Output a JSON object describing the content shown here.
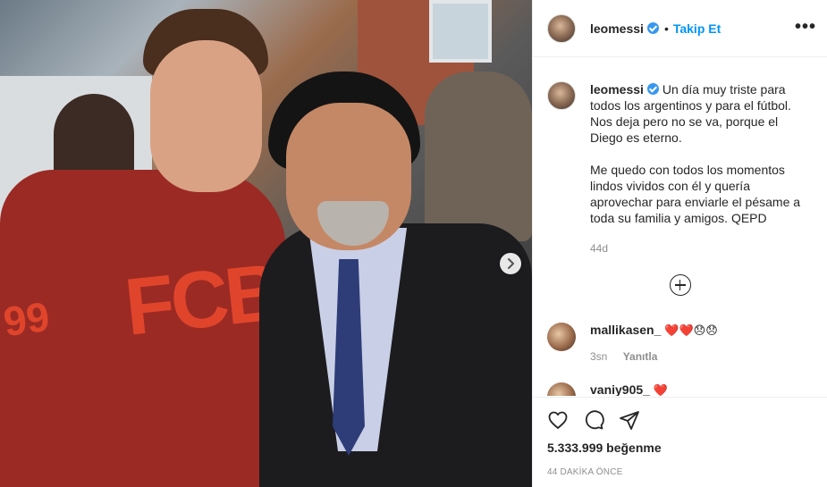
{
  "post": {
    "username": "leomessi",
    "follow_label": "Takip Et",
    "separator": "•",
    "more_label": "•••"
  },
  "caption": {
    "username": "leomessi",
    "paragraph1": "Un día muy triste para todos los argentinos y para el fútbol. Nos deja pero no se va, porque el Diego es eterno.",
    "paragraph2": "Me quedo con todos los momentos lindos vividos con él y quería aprovechar para enviarle el pésame a toda su familia y amigos. QEPD",
    "age": "44d"
  },
  "comments": [
    {
      "username": "mallikasen_",
      "text": "❤️❤️😞😞",
      "age": "3sn",
      "reply_label": "Yanıtla"
    },
    {
      "username": "vaniy905_",
      "text": "❤️",
      "age": "",
      "reply_label": ""
    }
  ],
  "footer": {
    "likes": "5.333.999 beğenme",
    "time": "44 DAKİKA ÖNCE"
  },
  "photo": {
    "hoodie_text": "FCB",
    "hoodie_number": "99"
  },
  "icons": {
    "like": "heart-icon",
    "comment": "comment-icon",
    "share": "share-icon",
    "next": "chevron-right-icon",
    "load_more": "plus-circle-icon"
  },
  "colors": {
    "accent": "#0095f6",
    "verified": "#3897f0",
    "muted": "#8e8e8e"
  }
}
